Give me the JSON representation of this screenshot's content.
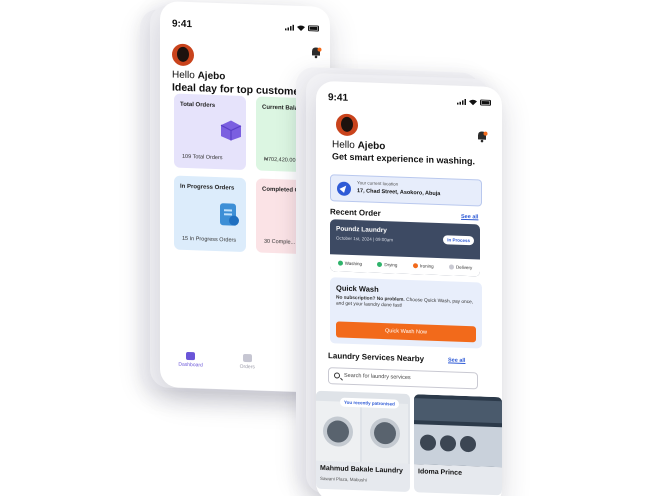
{
  "phone1": {
    "status_time": "9:41",
    "greeting_prefix": "Hello",
    "user_name": "Ajebo",
    "subtitle": "Ideal day for top customer care.",
    "cards": [
      {
        "title": "Total Orders",
        "value": "109 Total Orders",
        "bg": "#e6e3fb",
        "icon": "box-icon"
      },
      {
        "title": "Current Balance",
        "value": "₦702,420.00",
        "bg": "#dcf6e2",
        "icon": "wallet-icon"
      },
      {
        "title": "In Progress Orders",
        "value": "15 In Progress Orders",
        "bg": "#dcecfb",
        "icon": "document-icon"
      },
      {
        "title": "Completed O...",
        "value": "30 Comple...",
        "bg": "#fbe3e6",
        "icon": "check-icon"
      }
    ],
    "tabs": [
      "Dashboard",
      "Orders"
    ]
  },
  "phone2": {
    "status_time": "9:41",
    "greeting_prefix": "Hello",
    "user_name": "Ajebo",
    "subtitle": "Get smart experience in washing.",
    "location": {
      "caption": "Your current location",
      "address": "17, Chad Street, Asokoro, Abuja"
    },
    "recent_order": {
      "title": "Recent Order",
      "see_all": "See all",
      "name": "Poundz Laundry",
      "date": "October 1st, 2024 | 09:00am",
      "status": "In Process",
      "stages": [
        {
          "label": "Washing",
          "color": "#2fb36b"
        },
        {
          "label": "Drying",
          "color": "#2fb36b"
        },
        {
          "label": "Ironing",
          "color": "#f26a1b"
        },
        {
          "label": "Delivery",
          "color": "#c9c9d2"
        }
      ]
    },
    "quick_wash": {
      "title": "Quick Wash",
      "desc_bold": "No subscription? No problem.",
      "desc": "Choose Quick Wash, pay once, and get your laundry done fast!",
      "button": "Quick Wash Now"
    },
    "nearby": {
      "title": "Laundry Services Nearby",
      "see_all": "See all",
      "search_placeholder": "Search for laundry services",
      "items": [
        {
          "name": "Mahmud Bakale Laundry",
          "address": "Sawani Plaza, Mabushi",
          "tag": "You recently patronised"
        },
        {
          "name": "Idoma Prince",
          "address": ""
        }
      ]
    }
  },
  "colors": {
    "accent_blue": "#2f5bd6",
    "accent_orange": "#f26a1b",
    "order_card": "#3d4a63",
    "purple": "#6a55d8"
  }
}
